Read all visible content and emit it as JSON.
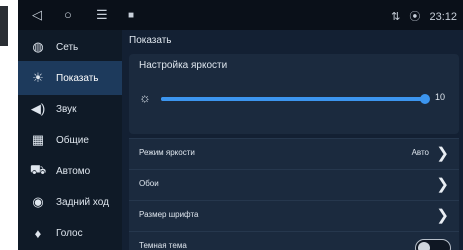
{
  "statusbar": {
    "time": "23:12",
    "signal": "⇅",
    "location_icon": "location-pin-icon"
  },
  "sidebar": {
    "items": [
      {
        "label": "Сеть",
        "icon": "globe-icon",
        "active": false
      },
      {
        "label": "Показать",
        "icon": "brightness-icon",
        "active": true
      },
      {
        "label": "Звук",
        "icon": "speaker-icon",
        "active": false
      },
      {
        "label": "Общие",
        "icon": "grid-icon",
        "active": false
      },
      {
        "label": "Автомо",
        "icon": "car-icon",
        "active": false
      },
      {
        "label": "Задний ход",
        "icon": "camera-icon",
        "active": false
      },
      {
        "label": "Голос",
        "icon": "microphone-icon",
        "active": false
      }
    ]
  },
  "main": {
    "title": "Показать",
    "brightness": {
      "title": "Настройка яркости",
      "value": "10",
      "level_fraction": 1.0
    },
    "rows": {
      "mode_label": "Режим яркости",
      "mode_value": "Авто",
      "wallpaper_label": "Обои",
      "font_label": "Размер шрифта",
      "dark_label": "Темная тема"
    },
    "dark_theme_on": false
  },
  "colors": {
    "accent": "#3c95ef",
    "active_item": "#1d3a5c",
    "background": "#132033"
  }
}
